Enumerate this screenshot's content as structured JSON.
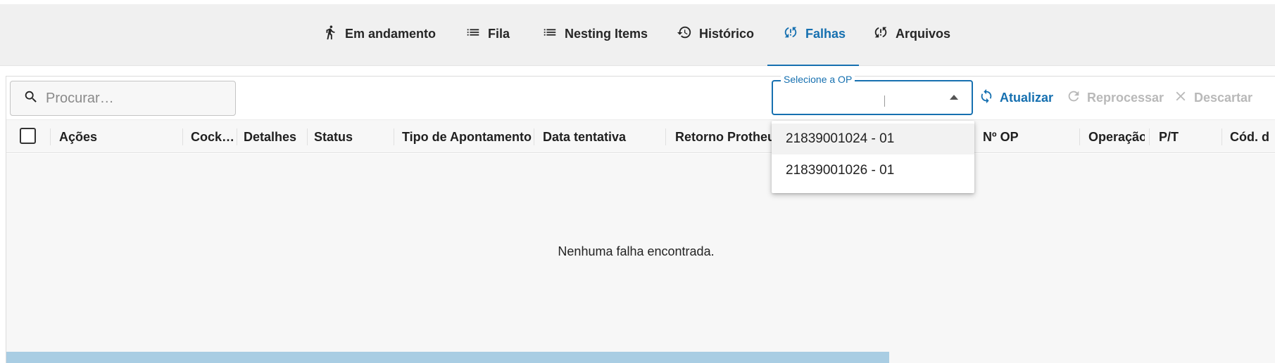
{
  "tabs": [
    {
      "label": "Em andamento",
      "icon": "running-person-icon",
      "active": false
    },
    {
      "label": "Fila",
      "icon": "list-icon",
      "active": false
    },
    {
      "label": "Nesting Items",
      "icon": "list-icon",
      "active": false
    },
    {
      "label": "Histórico",
      "icon": "history-icon",
      "active": false
    },
    {
      "label": "Falhas",
      "icon": "sync-problem-icon",
      "active": true
    },
    {
      "label": "Arquivos",
      "icon": "sync-problem-icon",
      "active": false
    }
  ],
  "search": {
    "placeholder": "Procurar…",
    "value": ""
  },
  "op_select": {
    "label": "Selecione a OP",
    "value": "",
    "options": [
      "21839001024 - 01",
      "21839001026 - 01"
    ]
  },
  "actions": {
    "refresh": "Atualizar",
    "reprocess": "Reprocessar",
    "discard": "Descartar"
  },
  "columns": [
    "Ações",
    "Cock…",
    "Detalhes",
    "Status",
    "Tipo de Apontamento",
    "Data tentativa",
    "Retorno Protheus",
    "Nº OP",
    "Operação",
    "P/T",
    "Cód. d"
  ],
  "empty_message": "Nenhuma falha encontrada.",
  "colors": {
    "accent": "#1670b0",
    "disabled": "#b9b9b9",
    "scroll_thumb": "#a9cde3"
  }
}
